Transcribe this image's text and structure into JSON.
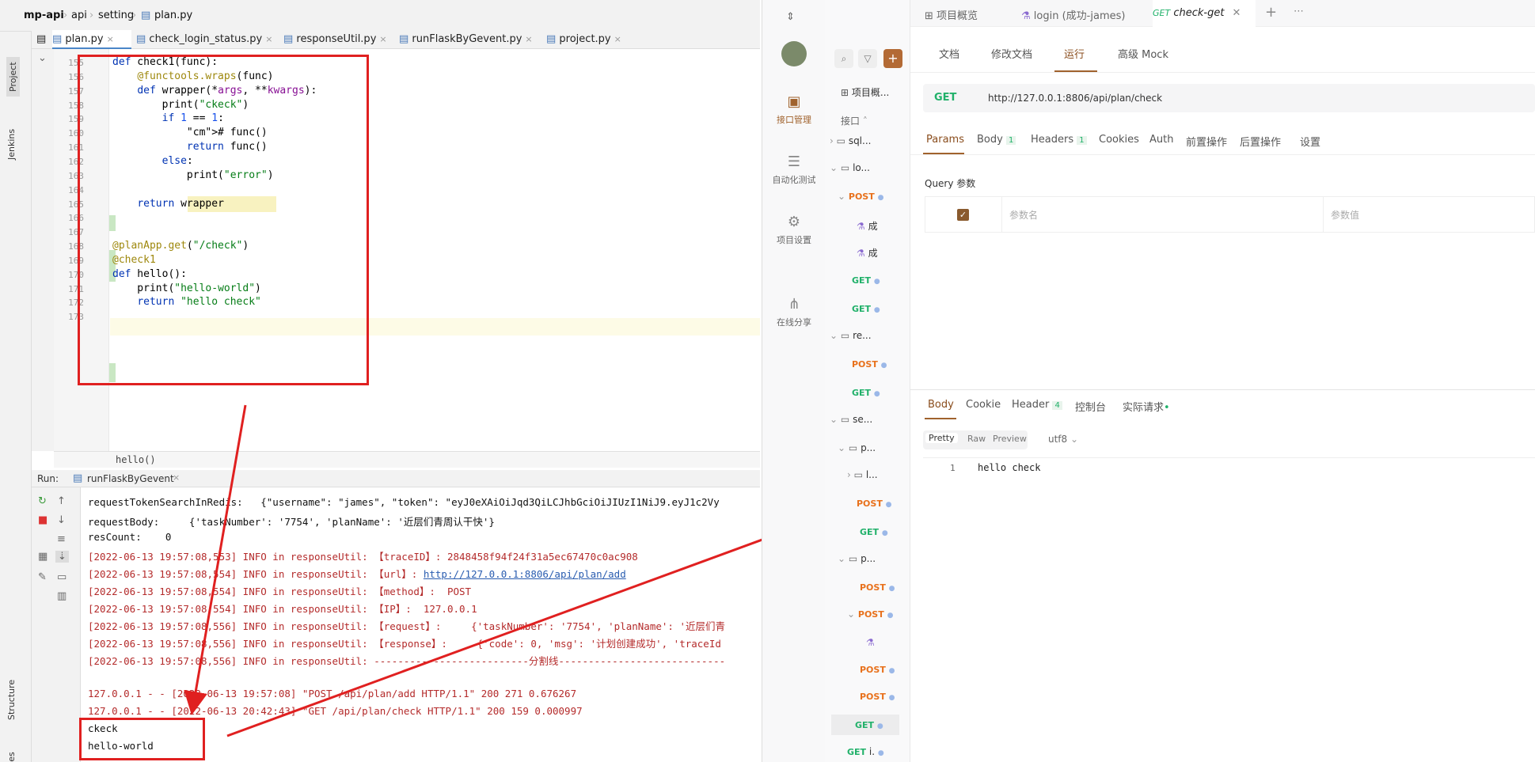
{
  "ide": {
    "breadcrumb": [
      "mp-api",
      "api",
      "setting",
      "plan.py"
    ],
    "left_panels": [
      "Project",
      "Jenkins",
      "Structure",
      "Favorites"
    ],
    "tabs": [
      "plan.py",
      "check_login_status.py",
      "responseUtil.py",
      "runFlaskByGevent.py",
      "project.py"
    ],
    "code_lines": [
      {
        "n": "155",
        "t": "def check1(func):"
      },
      {
        "n": "156",
        "t": "    @functools.wraps(func)"
      },
      {
        "n": "157",
        "t": "    def wrapper(*args, **kwargs):"
      },
      {
        "n": "158",
        "t": "        print(\"ckeck\")"
      },
      {
        "n": "159",
        "t": "        if 1 == 1:"
      },
      {
        "n": "160",
        "t": "            # func()"
      },
      {
        "n": "161",
        "t": "            return func()"
      },
      {
        "n": "162",
        "t": "        else:"
      },
      {
        "n": "163",
        "t": "            print(\"error\")"
      },
      {
        "n": "164",
        "t": ""
      },
      {
        "n": "165",
        "t": "    return wrapper"
      },
      {
        "n": "166",
        "t": ""
      },
      {
        "n": "167",
        "t": ""
      },
      {
        "n": "168",
        "t": "@planApp.get(\"/check\")"
      },
      {
        "n": "169",
        "t": "@check1"
      },
      {
        "n": "170",
        "t": "def hello():"
      },
      {
        "n": "171",
        "t": "    print(\"hello-world\")"
      },
      {
        "n": "172",
        "t": "    return \"hello check\""
      },
      {
        "n": "173",
        "t": ""
      }
    ],
    "hint": "hello()",
    "run_label": "Run:",
    "run_tab": "runFlaskByGevent",
    "output_lines": [
      {
        "t": "requestTokenSearchInRedis:   {\"username\": \"james\", \"token\": \"eyJ0eXAiOiJqd3QiLCJhbGciOiJIUzI1NiJ9.eyJ1c2Vy",
        "red": false
      },
      {
        "t": "requestBody:     {'taskNumber': '7754', 'planName': '近层们青周认干快'}",
        "red": false
      },
      {
        "t": "resCount:    0",
        "red": false
      },
      {
        "t": "[2022-06-13 19:57:08,553] INFO in responseUtil: 【traceID】: 2848458f94f24f31a5ec67470c0ac908",
        "red": true
      },
      {
        "t": "[2022-06-13 19:57:08,554] INFO in responseUtil: 【url】: http://127.0.0.1:8806/api/plan/add",
        "red": true
      },
      {
        "t": "[2022-06-13 19:57:08,554] INFO in responseUtil: 【method】:  POST",
        "red": true
      },
      {
        "t": "[2022-06-13 19:57:08,554] INFO in responseUtil: 【IP】:  127.0.0.1",
        "red": true
      },
      {
        "t": "[2022-06-13 19:57:08,556] INFO in responseUtil: 【request】:     {'taskNumber': '7754', 'planName': '近层们青",
        "red": true
      },
      {
        "t": "[2022-06-13 19:57:08,556] INFO in responseUtil: 【response】:     {'code': 0, 'msg': '计划创建成功', 'traceId",
        "red": true
      },
      {
        "t": "[2022-06-13 19:57:08,556] INFO in responseUtil: --------------------------分割线----------------------------",
        "red": true
      },
      {
        "t": "",
        "red": false
      },
      {
        "t": "127.0.0.1 - - [2022-06-13 19:57:08] \"POST /api/plan/add HTTP/1.1\" 200 271 0.676267",
        "red": true
      },
      {
        "t": "127.0.0.1 - - [2022-06-13 20:42:43] \"GET /api/plan/check HTTP/1.1\" 200 159 0.000997",
        "red": true
      },
      {
        "t": "ckeck",
        "red": false
      },
      {
        "t": "hello-world",
        "red": false
      }
    ]
  },
  "apifox": {
    "top_tabs": [
      "项目概览",
      "login (成功-james)",
      "check-get"
    ],
    "top_tab_active_method": "GET",
    "nav": [
      "接口管理",
      "自动化测试",
      "项目设置",
      "在线分享"
    ],
    "tree_header": "项目概...",
    "tree_section": "接口",
    "tree_items": [
      {
        "type": "folder",
        "label": "sql..."
      },
      {
        "type": "folder",
        "label": "lo..."
      },
      {
        "type": "method",
        "method": "POST"
      },
      {
        "type": "case",
        "label": "成"
      },
      {
        "type": "case",
        "label": "成"
      },
      {
        "type": "method",
        "method": "GET"
      },
      {
        "type": "method",
        "method": "GET"
      },
      {
        "type": "folder",
        "label": "re..."
      },
      {
        "type": "method",
        "method": "POST"
      },
      {
        "type": "method",
        "method": "GET"
      },
      {
        "type": "folder",
        "label": "se..."
      },
      {
        "type": "folder",
        "label": "p..."
      },
      {
        "type": "folder",
        "label": "l..."
      },
      {
        "type": "method",
        "method": "POST"
      },
      {
        "type": "method",
        "method": "GET"
      },
      {
        "type": "folder",
        "label": "p..."
      },
      {
        "type": "method",
        "method": "POST"
      },
      {
        "type": "method",
        "method": "POST"
      },
      {
        "type": "case",
        "label": ""
      },
      {
        "type": "method",
        "method": "POST"
      },
      {
        "type": "method",
        "method": "POST"
      },
      {
        "type": "method",
        "method": "GET"
      },
      {
        "type": "method",
        "method": "GET",
        "label": "i."
      }
    ],
    "sub_tabs": [
      "文档",
      "修改文档",
      "运行",
      "高级 Mock"
    ],
    "method": "GET",
    "url": "http://127.0.0.1:8806/api/plan/check",
    "param_tabs": [
      "Params",
      "Body",
      "Headers",
      "Cookies",
      "Auth",
      "前置操作",
      "后置操作",
      "设置"
    ],
    "body_count": "1",
    "headers_count": "1",
    "query_title": "Query 参数",
    "param_name_placeholder": "参数名",
    "param_value_placeholder": "参数值",
    "resp_tabs": [
      "Body",
      "Cookie",
      "Header",
      "控制台",
      "实际请求"
    ],
    "resp_header_count": "4",
    "format_tabs": [
      "Pretty",
      "Raw",
      "Preview"
    ],
    "encoding": "utf8",
    "resp_line_no": "1",
    "resp_body": "hello check"
  },
  "colors": {
    "annotation": "#e02020",
    "post": "#e8711c",
    "get": "#21b16a",
    "accent": "#a0622d"
  }
}
